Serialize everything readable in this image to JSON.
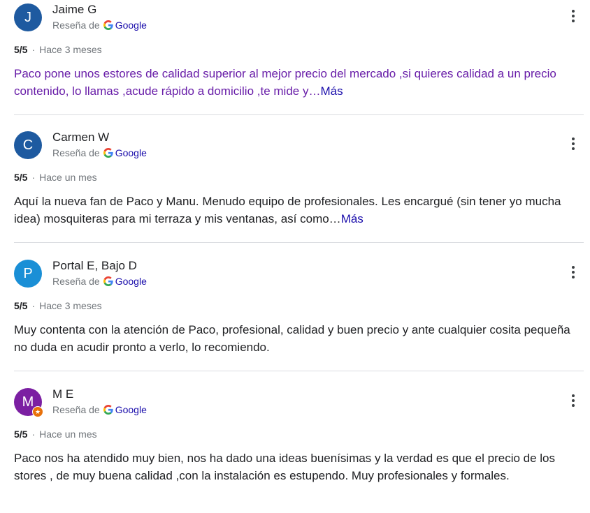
{
  "source_label": "Reseña de",
  "google_label": "Google",
  "more_label": "Más",
  "reviews": [
    {
      "initial": "J",
      "avatar_color": "#1e5aa0",
      "author": "Jaime G",
      "rating": "5/5",
      "time": "Hace 3 meses",
      "text": "Paco pone unos estores de calidad superior al mejor precio del mercado ,si quieres calidad a un precio contenido, lo llamas ,acude rápido a domicilio ,te mide y…",
      "truncated": true,
      "visited": true
    },
    {
      "initial": "C",
      "avatar_color": "#1e5aa0",
      "author": "Carmen W",
      "rating": "5/5",
      "time": "Hace un mes",
      "text": "Aquí la nueva fan de Paco y Manu. Menudo equipo de profesionales. Les encargué (sin tener yo mucha idea) mosquiteras para mi terraza y mis ventanas, así como…",
      "truncated": true,
      "visited": false
    },
    {
      "initial": "P",
      "avatar_color": "#1a8fd6",
      "author": "Portal E, Bajo D",
      "rating": "5/5",
      "time": "Hace 3 meses",
      "text": "Muy contenta con la atención de Paco, profesional, calidad y buen precio y ante cualquier cosita pequeña no duda en acudir pronto a verlo, lo recomiendo.",
      "truncated": false,
      "visited": false
    },
    {
      "initial": "M",
      "avatar_color": "#7b1fa2",
      "author": "M E",
      "rating": "5/5",
      "time": "Hace un mes",
      "text": "Paco nos ha atendido muy bien, nos ha dado una ideas buenísimas y la verdad es que el precio de los stores , de muy buena calidad ,con la instalación es estupendo. Muy profesionales y formales.",
      "truncated": false,
      "visited": false,
      "local_guide_badge": true
    }
  ]
}
